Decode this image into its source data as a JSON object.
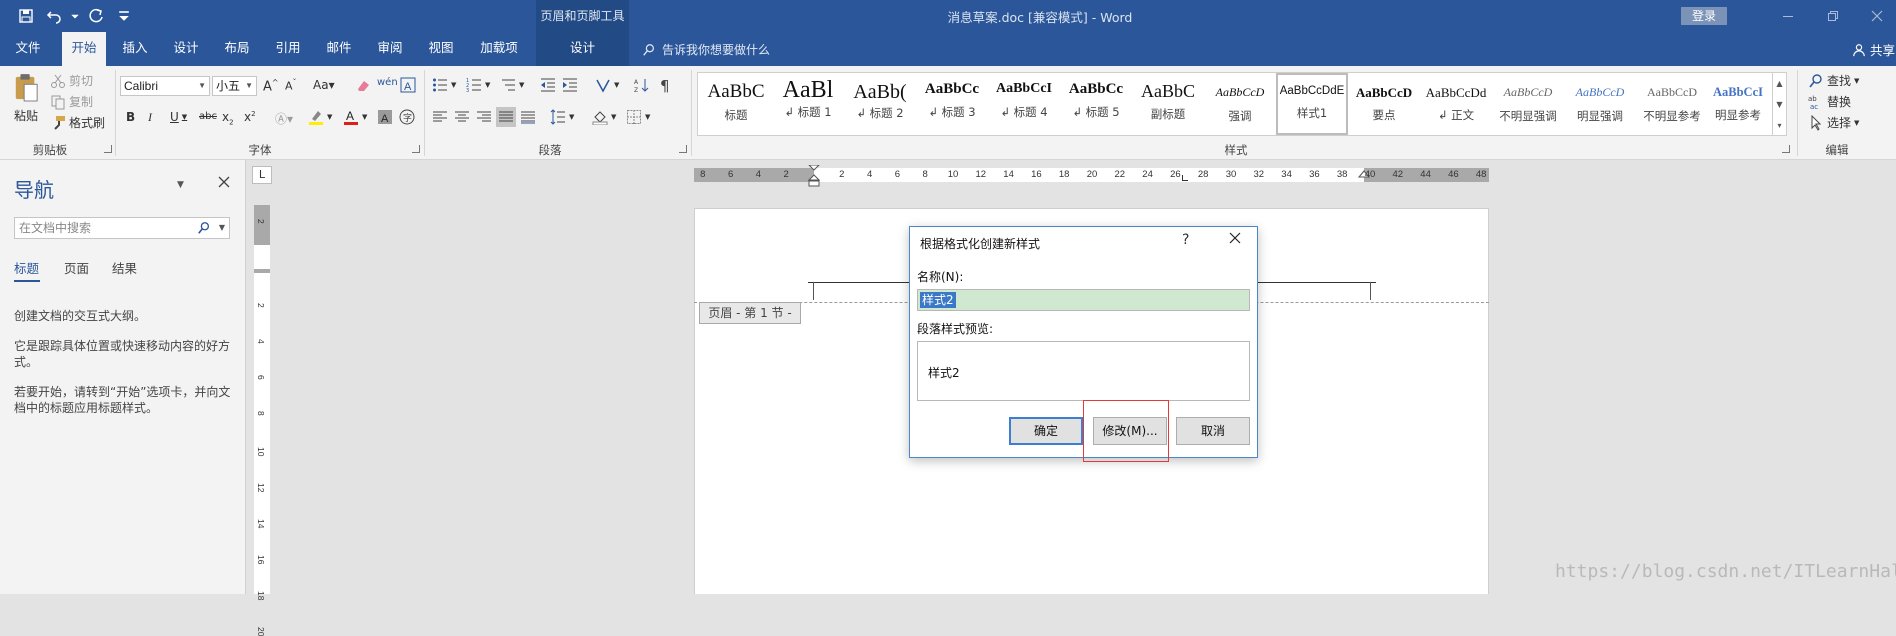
{
  "window": {
    "doc_title": "消息草案.doc [兼容模式] - Word",
    "context_group": "页眉和页脚工具",
    "login": "登录"
  },
  "tabs": [
    {
      "label": "文件"
    },
    {
      "label": "开始"
    },
    {
      "label": "插入"
    },
    {
      "label": "设计"
    },
    {
      "label": "布局"
    },
    {
      "label": "引用"
    },
    {
      "label": "邮件"
    },
    {
      "label": "审阅"
    },
    {
      "label": "视图"
    },
    {
      "label": "加载项"
    },
    {
      "label": "设计"
    }
  ],
  "tellme": "告诉我你想要做什么",
  "share": "共享",
  "ribbon": {
    "clipboard": {
      "paste": "粘贴",
      "cut": "剪切",
      "copy": "复制",
      "format_painter": "格式刷",
      "label": "剪贴板"
    },
    "font": {
      "name": "Calibri",
      "size": "小五",
      "label": "字体"
    },
    "paragraph": {
      "label": "段落"
    },
    "styles": {
      "label": "样式",
      "items": [
        {
          "sample": "AaBbC",
          "name": "标题"
        },
        {
          "sample": "AaBl",
          "name": "↲ 标题 1"
        },
        {
          "sample": "AaBb(",
          "name": "↲ 标题 2"
        },
        {
          "sample": "AaBbCc",
          "name": "↲ 标题 3"
        },
        {
          "sample": "AaBbCcI",
          "name": "↲ 标题 4"
        },
        {
          "sample": "AaBbCc",
          "name": "↲ 标题 5"
        },
        {
          "sample": "AaBbC",
          "name": "副标题"
        },
        {
          "sample": "AaBbCcD",
          "name": "强调"
        },
        {
          "sample": "AaBbCcDdE",
          "name": "样式1"
        },
        {
          "sample": "AaBbCcD",
          "name": "要点"
        },
        {
          "sample": "AaBbCcDd",
          "name": "↲ 正文"
        },
        {
          "sample": "AaBbCcD",
          "name": "不明显强调"
        },
        {
          "sample": "AaBbCcD",
          "name": "明显强调"
        },
        {
          "sample": "AaBbCcD",
          "name": "不明显参考"
        },
        {
          "sample": "AaBbCcI",
          "name": "明显参考"
        }
      ]
    },
    "editing": {
      "find": "查找",
      "replace": "替换",
      "select": "选择",
      "label": "编辑"
    }
  },
  "nav": {
    "title": "导航",
    "search_placeholder": "在文档中搜索",
    "tabs": [
      "标题",
      "页面",
      "结果"
    ],
    "p1": "创建文档的交互式大纲。",
    "p2": "它是跟踪具体位置或快速移动内容的好方式。",
    "p3": "若要开始，请转到“开始”选项卡，并向文档中的标题应用标题样式。"
  },
  "ruler": {
    "corner": "L",
    "h_numbers": [
      "8",
      "6",
      "4",
      "2",
      "2",
      "4",
      "6",
      "8",
      "10",
      "12",
      "14",
      "16",
      "18",
      "20",
      "22",
      "24",
      "26",
      "28",
      "30",
      "32",
      "34",
      "36",
      "38",
      "40",
      "42",
      "44",
      "46",
      "48"
    ],
    "v_numbers": [
      "2",
      "2",
      "4",
      "6",
      "8",
      "10",
      "12",
      "14",
      "16",
      "18",
      "20"
    ]
  },
  "document": {
    "header_tag": "页眉 - 第 1 节 -"
  },
  "dialog": {
    "title": "根据格式化创建新样式",
    "help": "?",
    "name_label": "名称(N):",
    "name_value": "样式2",
    "preview_label": "段落样式预览:",
    "preview_text": "样式2",
    "ok": "确定",
    "modify": "修改(M)...",
    "cancel": "取消"
  },
  "watermark": "https://blog.csdn.net/ITLearnHall",
  "colors": {
    "accent": "#2b579a",
    "highlight": "#e23a3a"
  }
}
